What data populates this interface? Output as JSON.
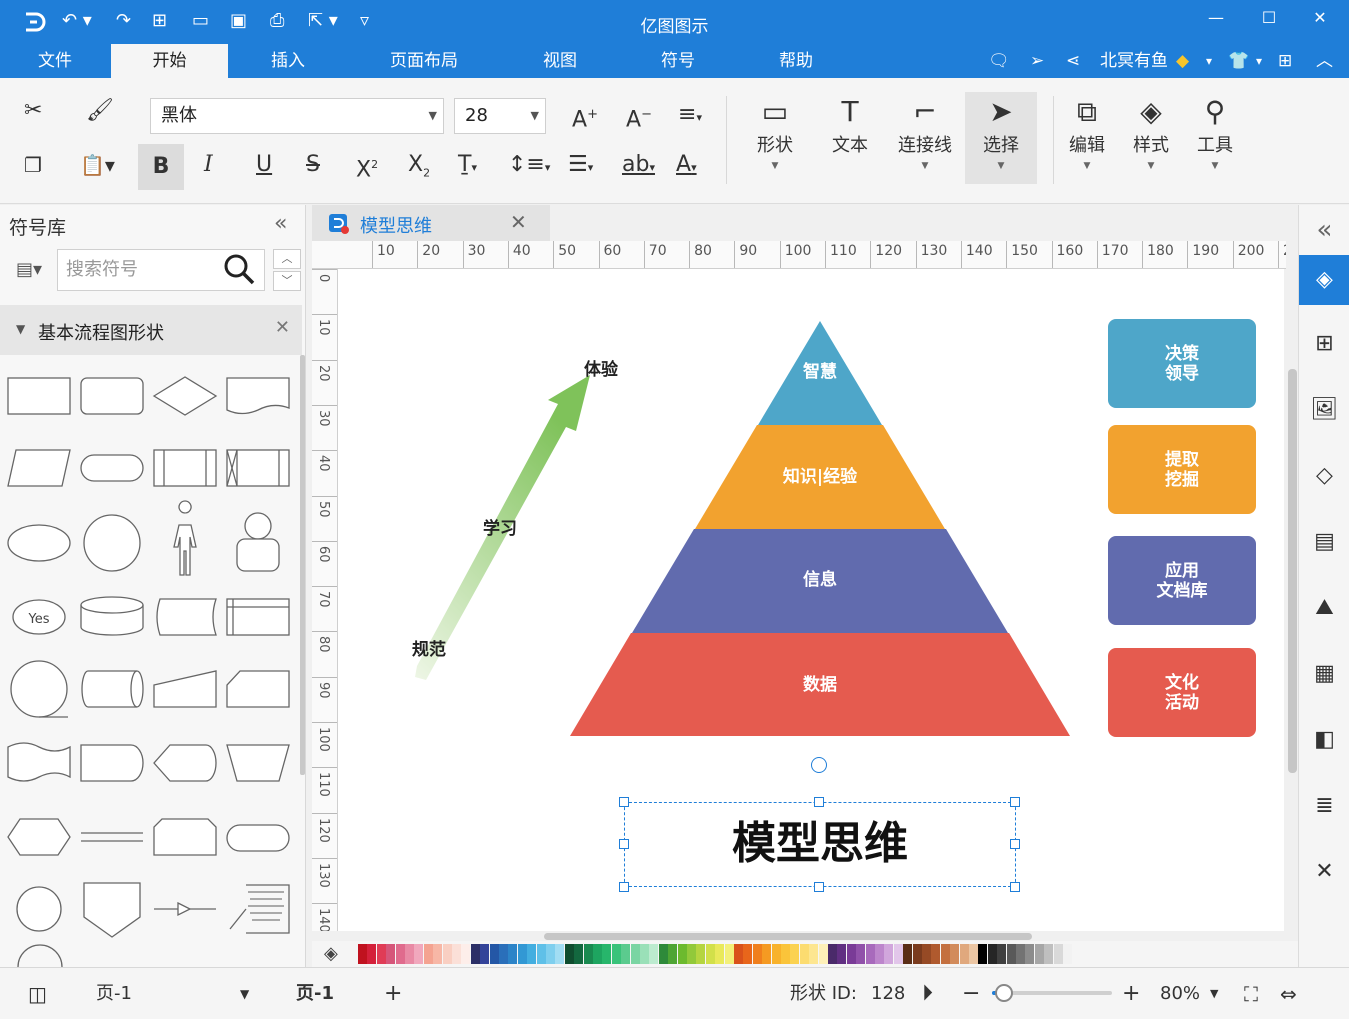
{
  "app": {
    "title": "亿图图示"
  },
  "menu": {
    "tabs": [
      "文件",
      "开始",
      "插入",
      "页面布局",
      "视图",
      "符号",
      "帮助"
    ],
    "active": "开始"
  },
  "user": {
    "name": "北冥有鱼"
  },
  "ribbon": {
    "font_name": "黑体",
    "font_size": "28",
    "shape_label": "形状",
    "text_label": "文本",
    "connector_label": "连接线",
    "select_label": "选择",
    "edit_label": "编辑",
    "style_label": "样式",
    "tools_label": "工具"
  },
  "symbol_panel": {
    "title": "符号库",
    "search_placeholder": "搜索符号",
    "category": "基本流程图形状",
    "yes_label": "Yes"
  },
  "document": {
    "tab_title": "模型思维"
  },
  "ruler": {
    "h_ticks": [
      "10",
      "20",
      "30",
      "40",
      "50",
      "60",
      "70",
      "80",
      "90",
      "100",
      "110",
      "120",
      "130",
      "140",
      "150",
      "160",
      "170",
      "180",
      "190",
      "200",
      "2"
    ],
    "v_ticks": [
      "0",
      "10",
      "20",
      "30",
      "40",
      "50",
      "60",
      "70",
      "80",
      "90",
      "100",
      "110",
      "120",
      "130",
      "140"
    ]
  },
  "diagram": {
    "pyramid": [
      {
        "label": "智慧",
        "color": "#4ea6c9"
      },
      {
        "label": "知识|经验",
        "color": "#f2a22f"
      },
      {
        "label": "信息",
        "color": "#616bae"
      },
      {
        "label": "数据",
        "color": "#e55b4f"
      }
    ],
    "cards": [
      {
        "label": "决策\n领导",
        "color": "#4ea6c9"
      },
      {
        "label": "提取\n挖掘",
        "color": "#f2a22f"
      },
      {
        "label": "应用\n文档库",
        "color": "#616bae"
      },
      {
        "label": "文化\n活动",
        "color": "#e55b4f"
      }
    ],
    "arrow_labels": {
      "top": "体验",
      "middle": "学习",
      "bottom": "规范"
    },
    "title": "模型思维"
  },
  "status": {
    "page_selector": "页-1",
    "page_tab": "页-1",
    "shape_id_label": "形状 ID:",
    "shape_id": "128",
    "zoom": "80%",
    "zoom_fraction": 0.1
  },
  "palette_colors": [
    "#c0121f",
    "#d4203a",
    "#e03c56",
    "#d6567a",
    "#e06b8d",
    "#e98aa5",
    "#f1a8bd",
    "#f4a391",
    "#f7b7a6",
    "#f9cfc2",
    "#fbe0d8",
    "#fdeeea",
    "#2b2f67",
    "#334399",
    "#2457a6",
    "#2a6fba",
    "#2c84c8",
    "#3298d4",
    "#43aee0",
    "#5fc0e8",
    "#7fcfee",
    "#a2ddf3",
    "#0f4d2f",
    "#13683f",
    "#198a50",
    "#1ea560",
    "#27b66b",
    "#39c37a",
    "#5bcb8e",
    "#7ad5a3",
    "#9ae0b8",
    "#bcebcf",
    "#2e8a3a",
    "#4ea534",
    "#6cba2e",
    "#92c93a",
    "#b5d540",
    "#d2e04a",
    "#e9e95a",
    "#f3f07a",
    "#d9521b",
    "#e8661b",
    "#f07f1d",
    "#f59a22",
    "#f8b22b",
    "#fac43a",
    "#fbd250",
    "#fcdc70",
    "#fde690",
    "#fef0b8",
    "#4a2a6a",
    "#612f82",
    "#7a3b97",
    "#9151aa",
    "#a86abc",
    "#bd86cc",
    "#d1a6dc",
    "#e2c6ea",
    "#5a2d16",
    "#7a3b1e",
    "#964a25",
    "#b05a2e",
    "#c4703f",
    "#d28b5b",
    "#e0a87d",
    "#ecc6a3",
    "#000000",
    "#262626",
    "#3f3f3f",
    "#595959",
    "#737373",
    "#8c8c8c",
    "#a6a6a6",
    "#bfbfbf",
    "#d9d9d9",
    "#f2f2f2"
  ]
}
